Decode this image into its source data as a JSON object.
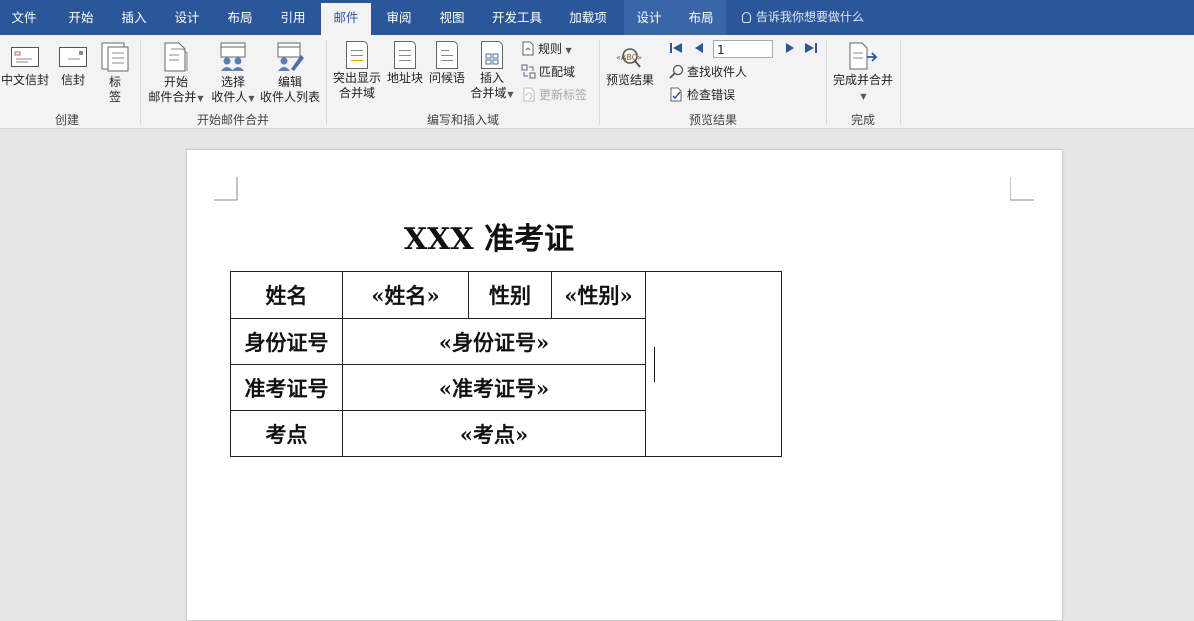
{
  "tabs": [
    {
      "label": "文件"
    },
    {
      "label": "开始"
    },
    {
      "label": "插入"
    },
    {
      "label": "设计"
    },
    {
      "label": "布局"
    },
    {
      "label": "引用"
    },
    {
      "label": "邮件"
    },
    {
      "label": "审阅"
    },
    {
      "label": "视图"
    },
    {
      "label": "开发工具"
    },
    {
      "label": "加载项"
    },
    {
      "label": "设计"
    },
    {
      "label": "布局"
    }
  ],
  "tell_me": "告诉我你想要做什么",
  "ribbon": {
    "create": {
      "label": "创建",
      "chinese_envelope": "中文信封",
      "envelope": "信封",
      "labels_line1": "标",
      "labels_line2": "签"
    },
    "start_merge": {
      "label": "开始邮件合并",
      "start_line1": "开始",
      "start_line2": "邮件合并",
      "select_line1": "选择",
      "select_line2": "收件人",
      "edit_line1": "编辑",
      "edit_line2": "收件人列表"
    },
    "write_insert": {
      "label": "编写和插入域",
      "highlight_line1": "突出显示",
      "highlight_line2": "合并域",
      "address_block": "地址块",
      "greeting": "问候语",
      "insert_line1": "插入",
      "insert_line2": "合并域",
      "rules": "规则",
      "match_fields": "匹配域",
      "update_labels": "更新标签"
    },
    "preview": {
      "label": "预览结果",
      "preview_results": "预览结果",
      "record_number": "1",
      "find_recipient": "查找收件人",
      "check_errors": "检查错误"
    },
    "finish": {
      "label": "完成",
      "finish_merge": "完成并合并"
    }
  },
  "document": {
    "title": "XXX 准考证",
    "rows": {
      "name_label": "姓名",
      "name_field": "«姓名»",
      "gender_label": "性别",
      "gender_field": "«性别»",
      "id_label": "身份证号",
      "id_field": "«身份证号»",
      "exam_no_label": "准考证号",
      "exam_no_field": "«准考证号»",
      "site_label": "考点",
      "site_field": "«考点»"
    }
  },
  "colors": {
    "tab_bar": "#2b579a",
    "ribbon_bg": "#f3f3f3",
    "workspace": "#e6e6e6",
    "page": "#ffffff"
  }
}
